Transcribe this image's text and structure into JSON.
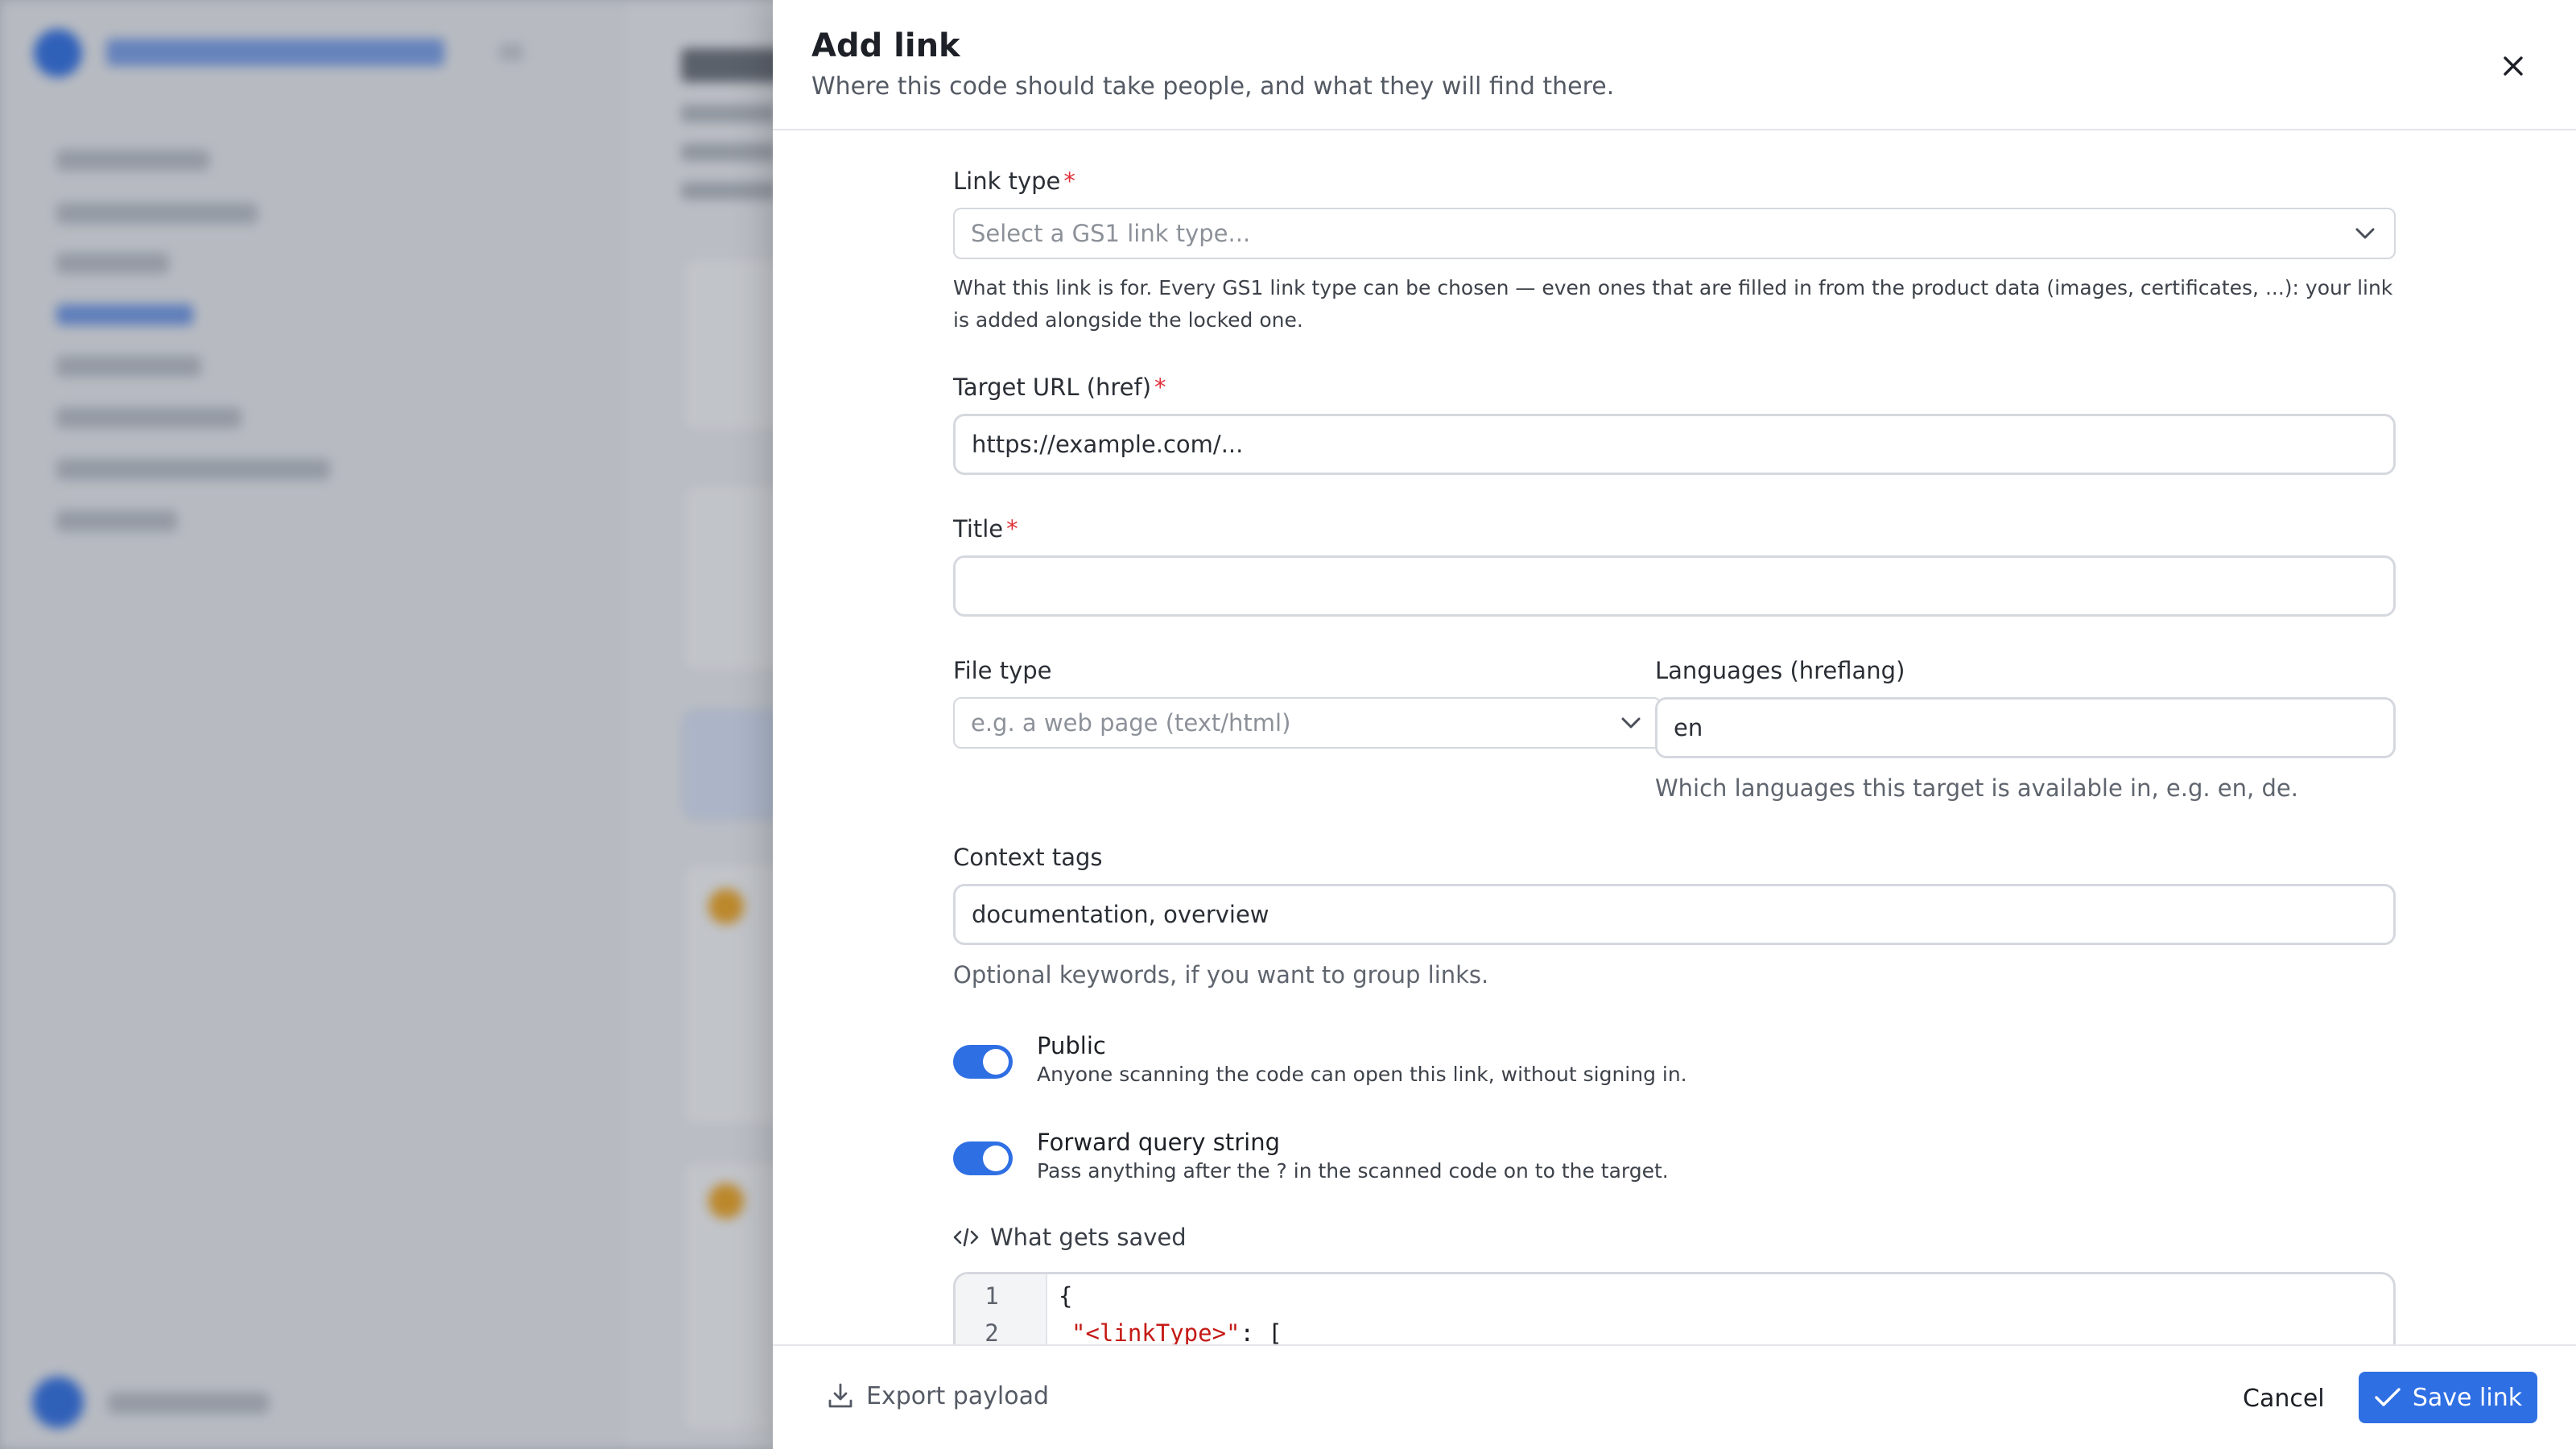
{
  "drawer": {
    "title": "Add link",
    "subtitle": "Where this code should take people, and what they will find there."
  },
  "form": {
    "link_type": {
      "label": "Link type",
      "required_mark": "*",
      "placeholder": "Select a GS1 link type...",
      "help": "What this link is for. Every GS1 link type can be chosen — even ones that are filled in from the product data (images, certificates, ...): your link is added alongside the locked one."
    },
    "target_url": {
      "label": "Target URL (href)",
      "required_mark": "*",
      "placeholder": "https://example.com/..."
    },
    "title": {
      "label": "Title",
      "required_mark": "*",
      "value": ""
    },
    "file_type": {
      "label": "File type",
      "placeholder": "e.g. a web page (text/html)"
    },
    "languages": {
      "label": "Languages (hreflang)",
      "value": "en",
      "help": "Which languages this target is available in, e.g. en, de."
    },
    "context_tags": {
      "label": "Context tags",
      "value": "documentation, overview",
      "help": "Optional keywords, if you want to group links."
    },
    "public": {
      "title": "Public",
      "description": "Anyone scanning the code can open this link, without signing in.",
      "on": true
    },
    "forward_query": {
      "title": "Forward query string",
      "description": "Pass anything after the ? in the scanned code on to the target.",
      "on": true
    },
    "preview": {
      "label": "What gets saved",
      "lines": [
        {
          "number": "1",
          "text": "{"
        },
        {
          "number": "2",
          "text_string": "\"<linkType>\"",
          "text_rest": ": ["
        }
      ]
    }
  },
  "footer": {
    "export_label": "Export payload",
    "cancel_label": "Cancel",
    "save_label": "Save link"
  },
  "colors": {
    "accent": "#2f6fe4",
    "required": "#e0313b",
    "code_string": "#c41a16"
  },
  "icons": {
    "close": "close-icon",
    "chevron": "chevron-down-icon",
    "code": "code-icon",
    "export": "download-icon",
    "save": "check-icon"
  }
}
